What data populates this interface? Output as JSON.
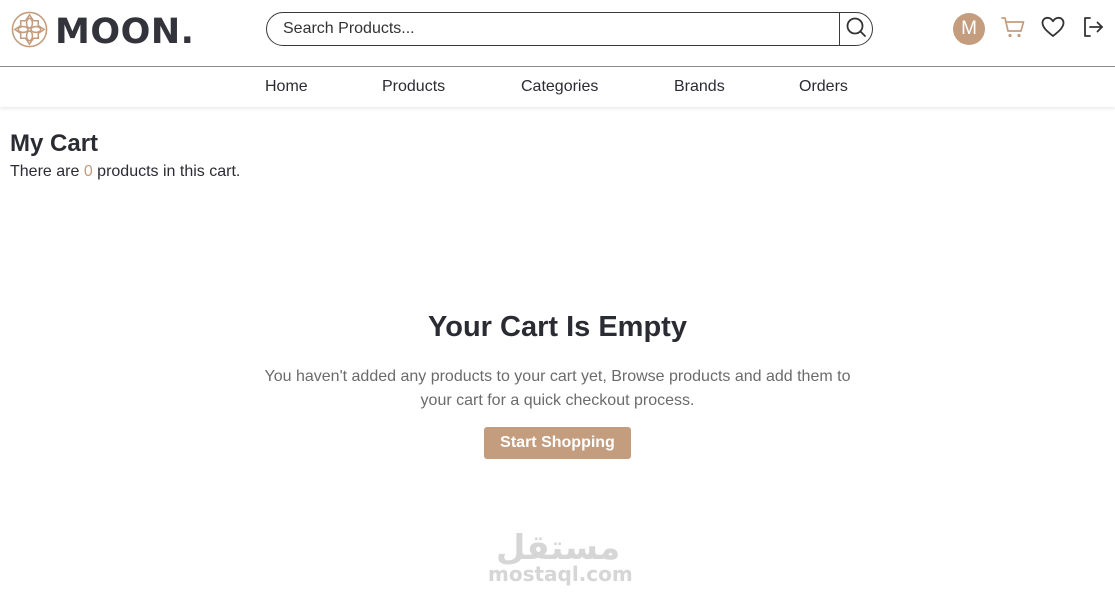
{
  "header": {
    "logo_text": "MOON.",
    "search": {
      "placeholder": "Search Products..."
    },
    "avatar_initial": "M",
    "icons": [
      "logo-flower-icon",
      "search-icon",
      "cart-icon",
      "heart-icon",
      "logout-icon"
    ]
  },
  "nav": {
    "items": [
      {
        "label": "Home"
      },
      {
        "label": "Products"
      },
      {
        "label": "Categories"
      },
      {
        "label": "Brands"
      },
      {
        "label": "Orders"
      }
    ]
  },
  "cart": {
    "title": "My Cart",
    "count_prefix": "There are ",
    "count": "0",
    "count_suffix": " products in this cart."
  },
  "empty": {
    "title": "Your Cart Is Empty",
    "description": "You haven't added any products to your cart yet, Browse products and add them to your cart for a quick checkout process.",
    "button_label": "Start Shopping"
  },
  "watermark": {
    "arabic": "مستقل",
    "latin": "mostaql.com"
  },
  "colors": {
    "accent": "#c49d7f",
    "text": "#2b2b33",
    "muted": "#6b6b6b"
  }
}
